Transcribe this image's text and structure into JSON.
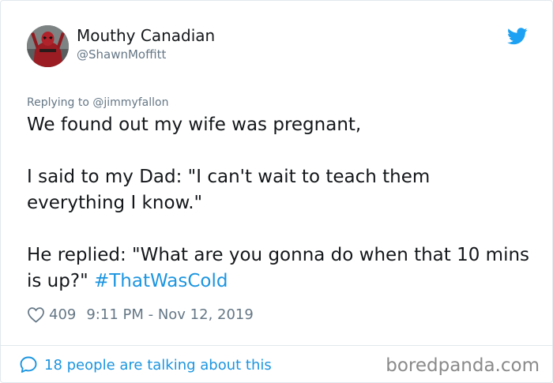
{
  "author": {
    "display_name": "Mouthy Canadian",
    "handle": "@ShawnMoffitt",
    "avatar_icon": "deadpool-avatar-icon"
  },
  "reply": {
    "prefix": "Replying to",
    "mention": "@jimmyfallon"
  },
  "tweet": {
    "line1": "We found out my wife was pregnant,",
    "para2": "I said to my Dad:   \"I can't wait to teach them everything I know.\"",
    "para3_text": "He replied: \"What are you gonna do when that 10 mins is up?\" ",
    "hashtag": "#ThatWasCold"
  },
  "meta": {
    "likes": "409",
    "timestamp": "9:11 PM - Nov 12, 2019"
  },
  "footer": {
    "talking": "18 people are talking about this",
    "watermark": "boredpanda.com"
  },
  "colors": {
    "link": "#1b95e0",
    "muted": "#657786",
    "text": "#14171a",
    "border": "#e1e8ed"
  }
}
